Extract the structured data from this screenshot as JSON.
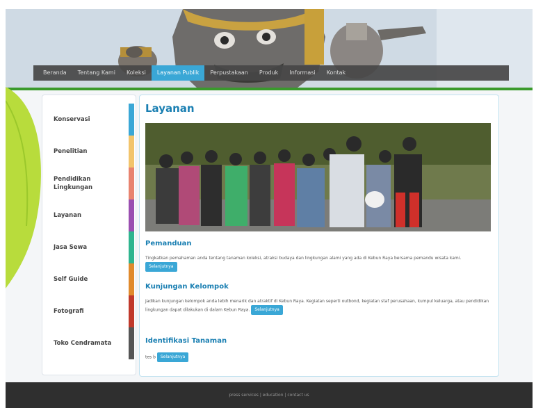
{
  "nav": {
    "items": [
      {
        "label": "Beranda",
        "active": false
      },
      {
        "label": "Tentang Kami",
        "active": false
      },
      {
        "label": "Koleksi",
        "active": false
      },
      {
        "label": "Layanan Publik",
        "active": true
      },
      {
        "label": "Perpustakaan",
        "active": false
      },
      {
        "label": "Produk",
        "active": false
      },
      {
        "label": "Informasi",
        "active": false
      },
      {
        "label": "Kontak",
        "active": false
      }
    ]
  },
  "sidebar": {
    "items": [
      {
        "label": "Konservasi",
        "color": "#3aa7d6"
      },
      {
        "label": "Penelitian",
        "color": "#f2c46b"
      },
      {
        "label": "Pendidikan Lingkungan",
        "color": "#e8836f"
      },
      {
        "label": "Layanan",
        "color": "#9a4fb0"
      },
      {
        "label": "Jasa Sewa",
        "color": "#2fb58f"
      },
      {
        "label": "Self Guide",
        "color": "#e08a2c"
      },
      {
        "label": "Fotografi",
        "color": "#c0392b"
      },
      {
        "label": "Toko Cendramata",
        "color": "#555555"
      }
    ]
  },
  "main": {
    "title": "Layanan",
    "sections": [
      {
        "title": "Pemanduan",
        "text": "Tingkatkan pemahaman anda tentang tanaman koleksi, atraksi budaya dan lingkungan alami yang ada di Kebun Raya bersama pemandu wisata kami.",
        "button": "Selanjutnya"
      },
      {
        "title": "Kunjungan Kelompok",
        "text": "Jadikan kunjungan kelompok anda lebih menarik dan atraktif di Kebun Raya. Kegiatan seperti outbond, kegiatan staf perusahaan, kumpul keluarga, atau pendidikan lingkungan dapat dilakukan di dalam Kebun Raya.",
        "button": "Selanjutnya"
      },
      {
        "title": "Identifikasi Tanaman",
        "text": "tes b",
        "button": "Selanjutnya"
      }
    ]
  },
  "footer": {
    "links": "press services | education | contact us"
  },
  "colors": {
    "accent": "#3aa7d6",
    "title_blue": "#1a7fb2",
    "green_line": "#3a9a2c"
  }
}
